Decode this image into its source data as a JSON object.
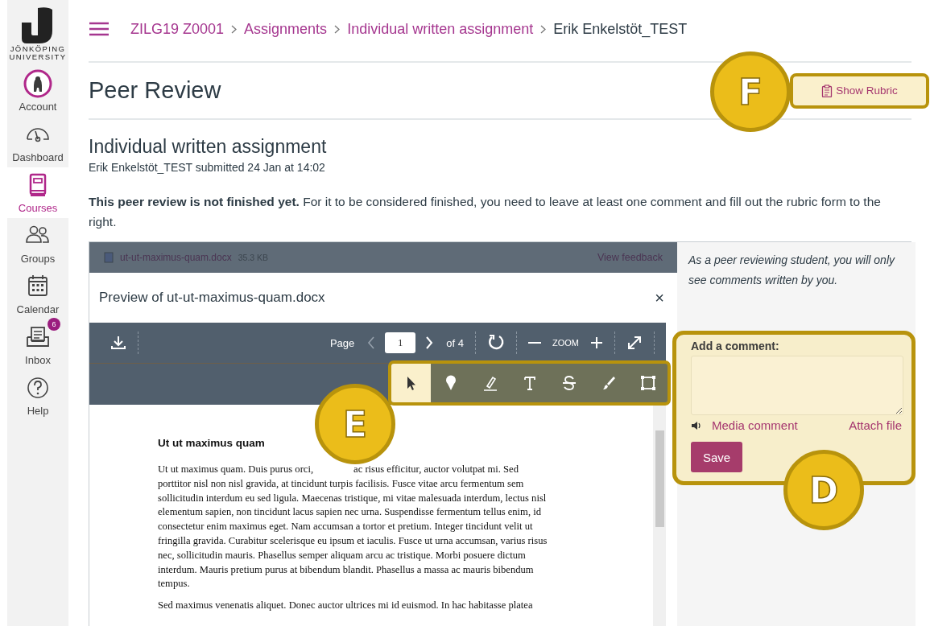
{
  "sidebar": {
    "logo_lines": [
      "JÖNKÖPING",
      "UNIVERSITY"
    ],
    "items": [
      {
        "kind": "account",
        "label": "Account",
        "selected": false
      },
      {
        "kind": "dashboard",
        "label": "Dashboard",
        "selected": false
      },
      {
        "kind": "courses",
        "label": "Courses",
        "selected": true
      },
      {
        "kind": "groups",
        "label": "Groups",
        "selected": false
      },
      {
        "kind": "calendar",
        "label": "Calendar",
        "selected": false
      },
      {
        "kind": "inbox",
        "label": "Inbox",
        "selected": false,
        "badge": "6"
      },
      {
        "kind": "help",
        "label": "Help",
        "selected": false
      }
    ]
  },
  "breadcrumb": [
    "ZILG19 Z0001",
    "Assignments",
    "Individual written assignment",
    "Erik Enkelstöt_TEST"
  ],
  "page_title": "Peer Review",
  "rubric_button": {
    "label": "Show Rubric",
    "callout": "F"
  },
  "assignment": {
    "title": "Individual written assignment",
    "submitted": "Erik Enkelstöt_TEST submitted 24 Jan at 14:02"
  },
  "notice": "**This peer review is not finished yet.** For it to be considered finished, you need to leave at least one comment and fill out the rubric form to the right.",
  "file_bar": {
    "file_name": "ut-ut-maximus-quam.docx",
    "file_size": "35.3 KB",
    "link": "View feedback"
  },
  "preview": {
    "title": "Preview of ut-ut-maximus-quam.docx",
    "close": "×",
    "toolbar": {
      "page_label": "Page",
      "page": "1",
      "page_count": "of 4",
      "zoom_label": "ZOOM"
    },
    "annotation_tools": [
      {
        "kind": "select",
        "selected": true
      },
      {
        "kind": "pin",
        "selected": false
      },
      {
        "kind": "highlight",
        "selected": false
      },
      {
        "kind": "text",
        "selected": false
      },
      {
        "kind": "strikeout",
        "selected": false
      },
      {
        "kind": "draw",
        "selected": false
      },
      {
        "kind": "area",
        "selected": false
      }
    ],
    "callout": "E",
    "document": {
      "heading": "Ut ut maximus quam",
      "paragraphs": [
        [
          [
            "Ut ut maximus quam. Duis purus orci,",
            "ac risus efficitur, auctor volutpat mi. Sed"
          ],
          [
            "porttitor nisl non nisl gravida, at tincidunt turpis facilisis. Fusce vitae arcu fermentum sem"
          ],
          [
            "sollicitudin interdum eu sed ligula. Maecenas tristique, mi vitae malesuada interdum, lectus nisl"
          ],
          [
            "elementum sapien, non tincidunt lacus sapien nec urna. Suspendisse fermentum tellus enim, id"
          ],
          [
            "consectetur enim maximus eget. Nam accumsan a tortor et pretium. Integer tincidunt velit ut"
          ],
          [
            "fringilla gravida. Curabitur scelerisque eu ipsum et iaculis. Fusce ut urna accumsan, varius risus"
          ],
          [
            "nec, sollicitudin mauris. Phasellus semper aliquam arcu ac tristique. Morbi posuere dictum"
          ],
          [
            "interdum. Mauris pretium purus at bibendum blandit. Phasellus a massa ac mauris bibendum"
          ],
          [
            "tempus."
          ]
        ],
        [
          [
            "Sed maximus venenatis aliquet. Donec auctor ultrices mi id euismod. In hac habitasse platea"
          ]
        ]
      ]
    }
  },
  "comments": {
    "note": "As a peer reviewing student, you will only see comments written by you.",
    "label": "Add a comment:",
    "media_link": "Media comment",
    "attach_link": "Attach file",
    "save": "Save",
    "callout": "D"
  }
}
